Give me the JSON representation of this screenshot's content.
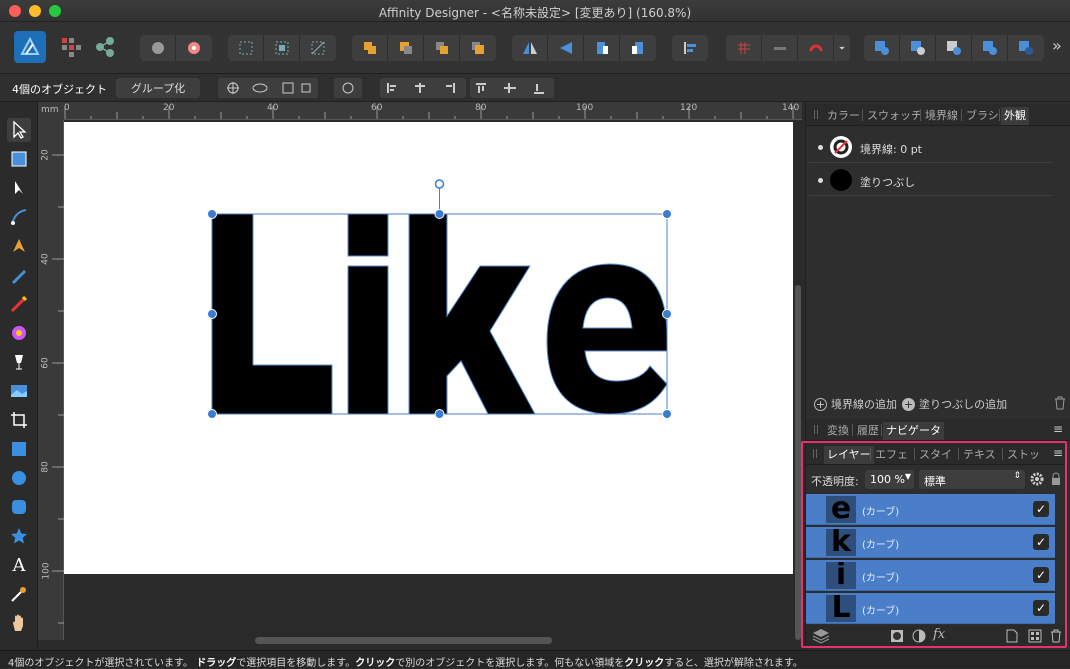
{
  "window": {
    "title": "Affinity Designer - <名称未設定> [変更あり] (160.8%)"
  },
  "context": {
    "selection_label": "4個のオブジェクト",
    "group_button": "グループ化"
  },
  "ruler": {
    "unit": "mm",
    "h_ticks": [
      "0",
      "20",
      "40",
      "60",
      "80",
      "100",
      "120",
      "140"
    ],
    "v_ticks": [
      "20",
      "40",
      "60",
      "80",
      "100"
    ]
  },
  "canvas": {
    "text": "Like"
  },
  "appearance_panel": {
    "tabs": [
      "カラー",
      "スウォッチ",
      "境界線",
      "ブラシ",
      "外観"
    ],
    "active_tab": "外観",
    "stroke_label": "境界線: 0 pt",
    "fill_label": "塗りつぶし",
    "add_stroke": "境界線の追加",
    "add_fill": "塗りつぶしの追加"
  },
  "nav_panel": {
    "tabs": [
      "変換",
      "履歴",
      "ナビゲータ"
    ],
    "active_tab": "ナビゲータ"
  },
  "layers_panel": {
    "tabs": [
      "レイヤー",
      "エフェ",
      "スタイ",
      "テキス",
      "ストッ"
    ],
    "active_tab": "レイヤー",
    "opacity_label": "不透明度:",
    "opacity_value": "100 %",
    "blend_mode": "標準",
    "layers": [
      {
        "name": "(カーブ)",
        "thumb": "e",
        "visible": true
      },
      {
        "name": "(カーブ)",
        "thumb": "k",
        "visible": true
      },
      {
        "name": "(カーブ)",
        "thumb": "i",
        "visible": true
      },
      {
        "name": "(カーブ)",
        "thumb": "L",
        "visible": true
      }
    ]
  },
  "status": {
    "p1": "4個のオブジェクトが選択されています。",
    "b1": "ドラッグ",
    "p2": "で選択項目を移動します。",
    "b2": "クリック",
    "p3": "で別のオブジェクトを選択します。何もない領域を",
    "b3": "クリック",
    "p4": "すると、選択が解除されます。"
  },
  "colors": {
    "accent": "#3a7bd5",
    "selection": "#4a7ec8",
    "highlight": "#e8316c"
  }
}
